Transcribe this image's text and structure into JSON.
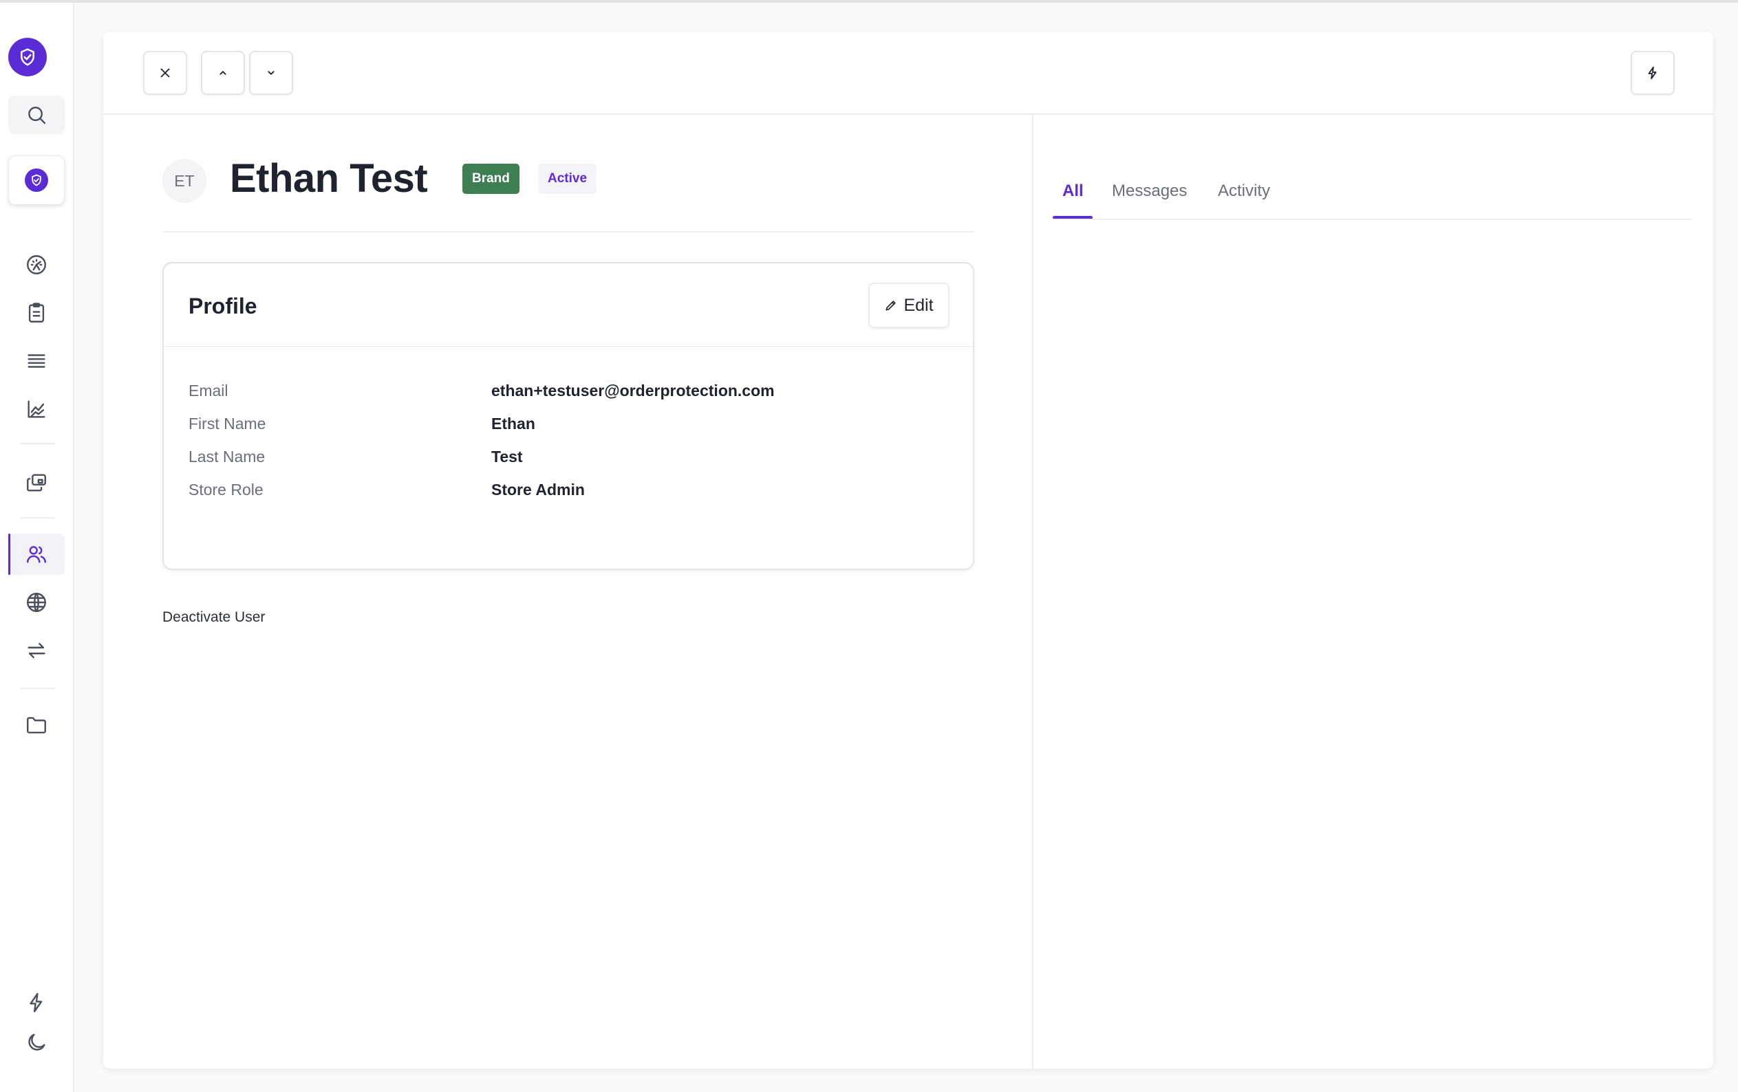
{
  "user": {
    "initials": "ET",
    "name": "Ethan Test",
    "badge_brand": "Brand",
    "badge_status": "Active"
  },
  "profile": {
    "title": "Profile",
    "edit_label": "Edit",
    "fields": [
      {
        "label": "Email",
        "value": "ethan+testuser@orderprotection.com"
      },
      {
        "label": "First Name",
        "value": "Ethan"
      },
      {
        "label": "Last Name",
        "value": "Test"
      },
      {
        "label": "Store Role",
        "value": "Store Admin"
      }
    ]
  },
  "actions": {
    "deactivate_label": "Deactivate User"
  },
  "tabs": [
    {
      "label": "All",
      "active": true
    },
    {
      "label": "Messages",
      "active": false
    },
    {
      "label": "Activity",
      "active": false
    }
  ],
  "colors": {
    "accent": "#5b2bd6",
    "brand_badge": "#3d7f52",
    "status_badge_bg": "#f4f3f8"
  },
  "icons": {
    "sidebar_top": [
      "shield-check-icon",
      "search-icon",
      "store-shield-icon"
    ],
    "sidebar_nav": [
      "dashboard-gauge-icon",
      "clipboard-icon",
      "list-rows-icon",
      "chart-line-icon",
      "image-stack-icon",
      "users-icon",
      "globe-icon",
      "arrows-swap-icon",
      "folder-icon"
    ],
    "sidebar_bottom": [
      "lightning-icon",
      "moon-icon"
    ],
    "toolbar": [
      "close-icon",
      "chevron-up-icon",
      "chevron-down-icon",
      "lightning-icon"
    ]
  }
}
